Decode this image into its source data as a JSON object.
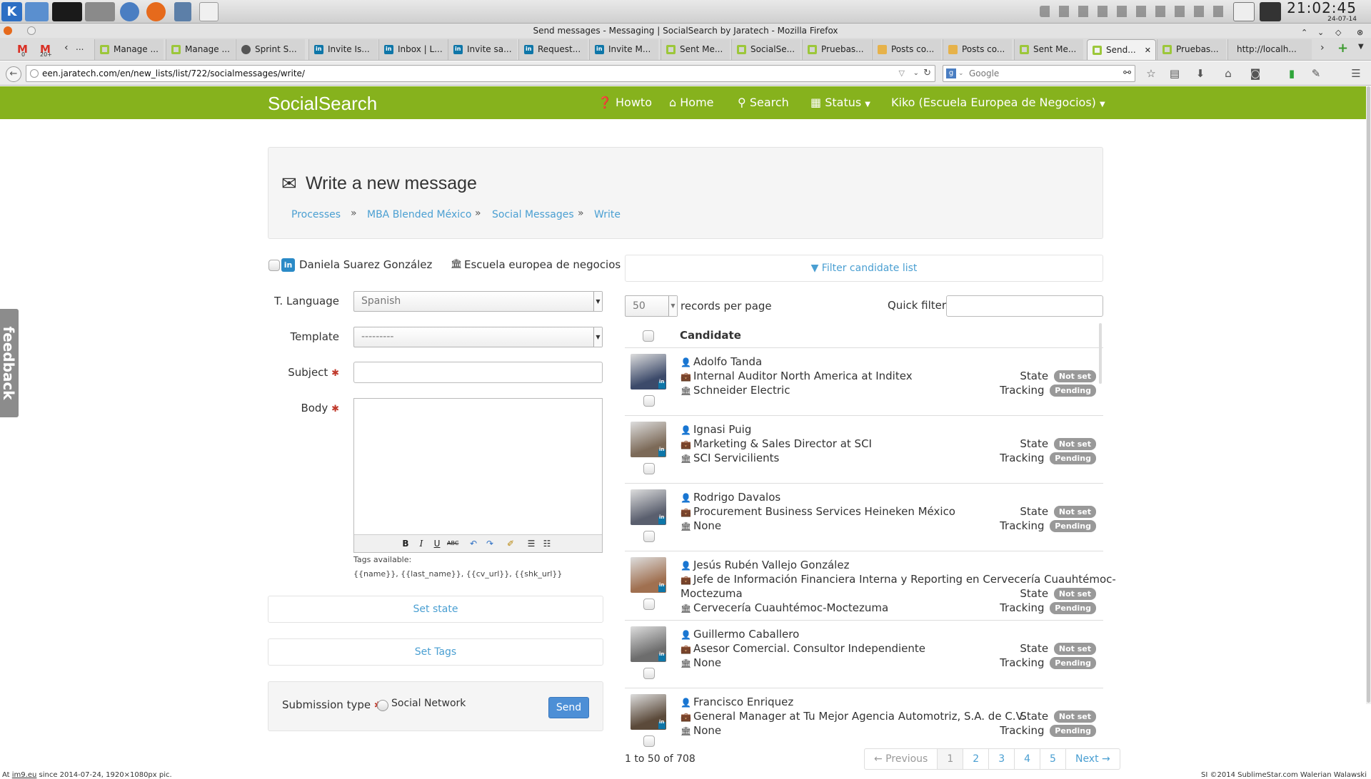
{
  "window": {
    "title": "Send messages - Messaging | SocialSearch by Jaratech - Mozilla Firefox"
  },
  "clock": {
    "time": "21:02:45",
    "date": "24-07-14"
  },
  "tabs": [
    {
      "label": "Manage ...",
      "icon": "pin"
    },
    {
      "label": "Manage ...",
      "icon": "pin"
    },
    {
      "label": "Sprint S...",
      "icon": "gear"
    },
    {
      "label": "Invite Is...",
      "icon": "linkedin"
    },
    {
      "label": "Inbox | L...",
      "icon": "linkedin"
    },
    {
      "label": "Invite sa...",
      "icon": "linkedin"
    },
    {
      "label": "Request...",
      "icon": "linkedin"
    },
    {
      "label": "Invite M...",
      "icon": "linkedin"
    },
    {
      "label": "Sent Me...",
      "icon": "pin"
    },
    {
      "label": "SocialSe...",
      "icon": "pin"
    },
    {
      "label": "Pruebas...",
      "icon": "pin"
    },
    {
      "label": "Posts co...",
      "icon": "page"
    },
    {
      "label": "Posts co...",
      "icon": "page"
    },
    {
      "label": "Sent Me...",
      "icon": "pin"
    },
    {
      "label": "Send...",
      "icon": "pin",
      "active": true
    },
    {
      "label": "Pruebas...",
      "icon": "pin"
    },
    {
      "label": "http://localh...",
      "icon": "none"
    }
  ],
  "gmail_count": "20+",
  "gmail_count_m": "0",
  "url": "een.jaratech.com/en/new_lists/list/722/socialmessages/write/",
  "search_placeholder": "Google",
  "app": {
    "brand": "SocialSearch",
    "nav": {
      "howto": "Howto",
      "home": "Home",
      "search": "Search",
      "status": "Status",
      "user": "Kiko (Escuela Europea de Negocios)"
    }
  },
  "feedback": "feedback",
  "panel": {
    "title": "Write a new message",
    "breadcrumbs": [
      "Processes",
      "MBA Blended México",
      "Social Messages",
      "Write"
    ]
  },
  "form": {
    "sender_name": "Daniela Suarez González",
    "sender_org": "Escuela europea de negocios",
    "language_label": "T. Language",
    "language_value": "Spanish",
    "template_label": "Template",
    "template_value": "---------",
    "subject_label": "Subject",
    "body_label": "Body",
    "tags_title": "Tags available:",
    "tags_list": "{{name}}, {{last_name}}, {{cv_url}}, {{shk_url}}",
    "set_state": "Set state",
    "set_tags": "Set Tags",
    "submission_label": "Submission type",
    "submission_option": "Social Network",
    "send": "Send"
  },
  "list": {
    "filter_label": "Filter candidate list",
    "per_page_value": "50",
    "per_page_label": "records per page",
    "quick_filter_label": "Quick filter:",
    "column_header": "Candidate",
    "state_label": "State",
    "tracking_label": "Tracking",
    "candidates": [
      {
        "name": "Adolfo Tanda",
        "position": "Internal Auditor North America at Inditex",
        "company": "Schneider Electric",
        "state": "Not set",
        "tracking": "Pending"
      },
      {
        "name": "Ignasi Puig",
        "position": "Marketing & Sales Director at SCI",
        "company": "SCI Servicilients",
        "state": "Not set",
        "tracking": "Pending"
      },
      {
        "name": "Rodrigo Davalos",
        "position": "Procurement Business Services Heineken México",
        "company": "None",
        "state": "Not set",
        "tracking": "Pending"
      },
      {
        "name": "Jesús Rubén Vallejo González",
        "position": "Jefe de Información Financiera Interna y Reporting en Cervecería Cuauhtémoc-",
        "position_cont": "Moctezuma",
        "company": "Cervecería Cuauhtémoc-Moctezuma",
        "state": "Not set",
        "tracking": "Pending"
      },
      {
        "name": "Guillermo Caballero",
        "position": "Asesor Comercial. Consultor Independiente",
        "company": "None",
        "state": "Not set",
        "tracking": "Pending"
      },
      {
        "name": "Francisco Enriquez",
        "position": "General Manager at Tu Mejor Agencia Automotriz, S.A. de C.V.",
        "company": "None",
        "state": "Not set",
        "tracking": "Pending"
      }
    ],
    "summary": "1 to 50 of 708",
    "pagination": [
      "← Previous",
      "1",
      "2",
      "3",
      "4",
      "5",
      "Next →"
    ]
  },
  "status_left_prefix": "At",
  "status_left_link": "im9.eu",
  "status_left_suffix": "since 2014-07-24, 1920×1080px pic.",
  "status_right": "SI ©2014 SublimeStar.com Walerian Walawski",
  "colors": {
    "brand_green": "#86b21d",
    "link_blue": "#4a9fd2",
    "badge_grey": "#999999",
    "send_blue": "#4d8fd6"
  }
}
